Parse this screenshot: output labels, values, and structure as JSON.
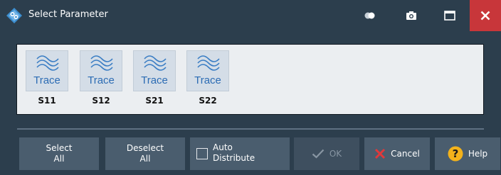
{
  "window": {
    "title": "Select Parameter"
  },
  "titlebar_icons": {
    "app": "rohde-schwarz-logo-icon",
    "toggle": "toggle-icon",
    "screenshot": "camera-icon",
    "maximize": "maximize-icon",
    "close": "close-icon"
  },
  "traces": [
    {
      "icon_label": "Trace",
      "caption": "S11"
    },
    {
      "icon_label": "Trace",
      "caption": "S12"
    },
    {
      "icon_label": "Trace",
      "caption": "S21"
    },
    {
      "icon_label": "Trace",
      "caption": "S22"
    }
  ],
  "buttons": {
    "select_all": {
      "line1": "Select",
      "line2": "All"
    },
    "deselect_all": {
      "line1": "Deselect",
      "line2": "All"
    },
    "auto_distribute": {
      "line1": "Auto",
      "line2": "Distribute",
      "checked": false
    },
    "ok": {
      "label": "OK",
      "enabled": false
    },
    "cancel": {
      "label": "Cancel"
    },
    "help": {
      "label": "Help"
    }
  },
  "colors": {
    "background": "#2c3e4d",
    "close_button": "#c8363a",
    "trace_blue": "#2c6cb4",
    "panel": "#ebeef1",
    "help_yellow": "#f3b21b",
    "cancel_red": "#e0393b"
  }
}
